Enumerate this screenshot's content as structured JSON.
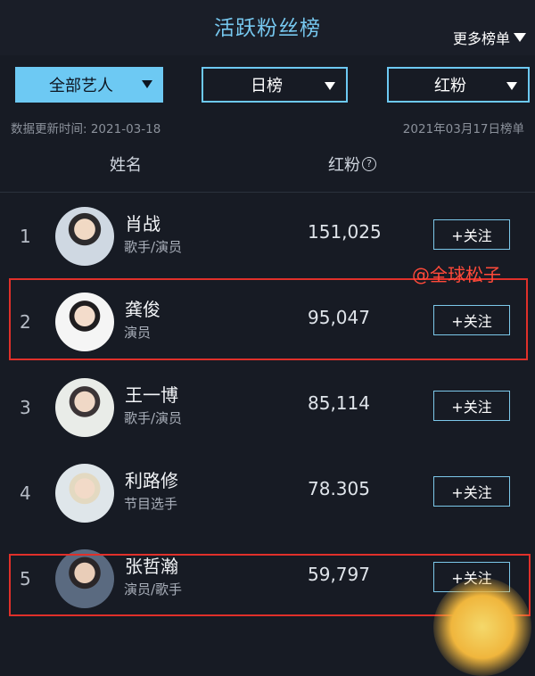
{
  "header": {
    "title": "活跃粉丝榜",
    "more_label": "更多榜单"
  },
  "filters": {
    "artist": "全部艺人",
    "period": "日榜",
    "metric": "红粉"
  },
  "update_text": "数据更新时间: 2021-03-18",
  "list_date": "2021年03月17日榜单",
  "columns": {
    "name": "姓名",
    "fans": "红粉",
    "help_icon": "?"
  },
  "rows": [
    {
      "rank": "1",
      "name": "肖战",
      "role": "歌手/演员",
      "count": "151,025",
      "follow": "+关注"
    },
    {
      "rank": "2",
      "name": "龚俊",
      "role": "演员",
      "count": "95,047",
      "follow": "+关注"
    },
    {
      "rank": "3",
      "name": "王一博",
      "role": "歌手/演员",
      "count": "85,114",
      "follow": "+关注"
    },
    {
      "rank": "4",
      "name": "利路修",
      "role": "节目选手",
      "count": "78.305",
      "follow": "+关注"
    },
    {
      "rank": "5",
      "name": "张哲瀚",
      "role": "演员/歌手",
      "count": "59,797",
      "follow": "+关注"
    }
  ],
  "watermark": "@全球松子",
  "colors": {
    "accent": "#6dc9f3",
    "highlight": "#e0302a",
    "background": "#171b24"
  }
}
